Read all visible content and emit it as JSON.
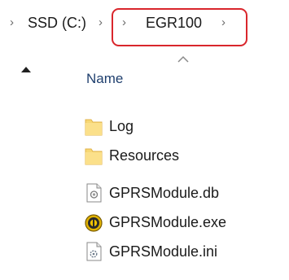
{
  "address_bar": {
    "breadcrumbs": [
      "SSD (C:)",
      "EGR100"
    ],
    "separator_glyph": "›",
    "highlight_color": "#d9262c"
  },
  "file_list": {
    "column_header": "Name",
    "sort_direction": "ascending",
    "items": [
      {
        "name": "Log",
        "icon": "folder-icon"
      },
      {
        "name": "Resources",
        "icon": "folder-icon"
      },
      {
        "name": "GPRSModule.db",
        "icon": "database-file-icon"
      },
      {
        "name": "GPRSModule.exe",
        "icon": "application-icon"
      },
      {
        "name": "GPRSModule.ini",
        "icon": "settings-file-icon"
      }
    ]
  }
}
